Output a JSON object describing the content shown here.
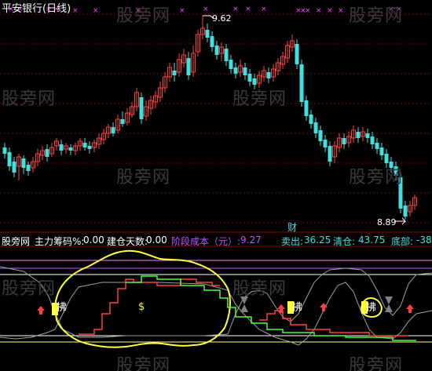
{
  "main_chart": {
    "title": "平安银行(日线)",
    "watermark": "股旁网",
    "high_label": "9.62",
    "low_label": "8.89",
    "signal_label": "财"
  },
  "indicator": {
    "items": [
      {
        "name": "股旁网",
        "value": "",
        "color": "#ffffff"
      },
      {
        "name": "主力筹码%:",
        "value": "0.00",
        "color": "#ffffff"
      },
      {
        "name": "建仓天数:",
        "value": "0.00",
        "color": "#ffffff"
      },
      {
        "name": "阶段成本（元）:",
        "value": "9.27",
        "color": "#c050ff"
      },
      {
        "name": "卖出:",
        "value": "36.25",
        "color": "#40e0e0"
      },
      {
        "name": "清仓:",
        "value": "43.75",
        "color": "#40e0e0"
      },
      {
        "name": "底部:",
        "value": "-38.",
        "color": "#40e0e0"
      }
    ],
    "buy_label": "拂",
    "dollar_label": "$"
  },
  "colors": {
    "up": "#ff4040",
    "down": "#40e0e0",
    "grid": "#8b0000",
    "cross": "#ff40ff",
    "yellow": "#ffff40",
    "gray": "#a0a0a0"
  }
}
